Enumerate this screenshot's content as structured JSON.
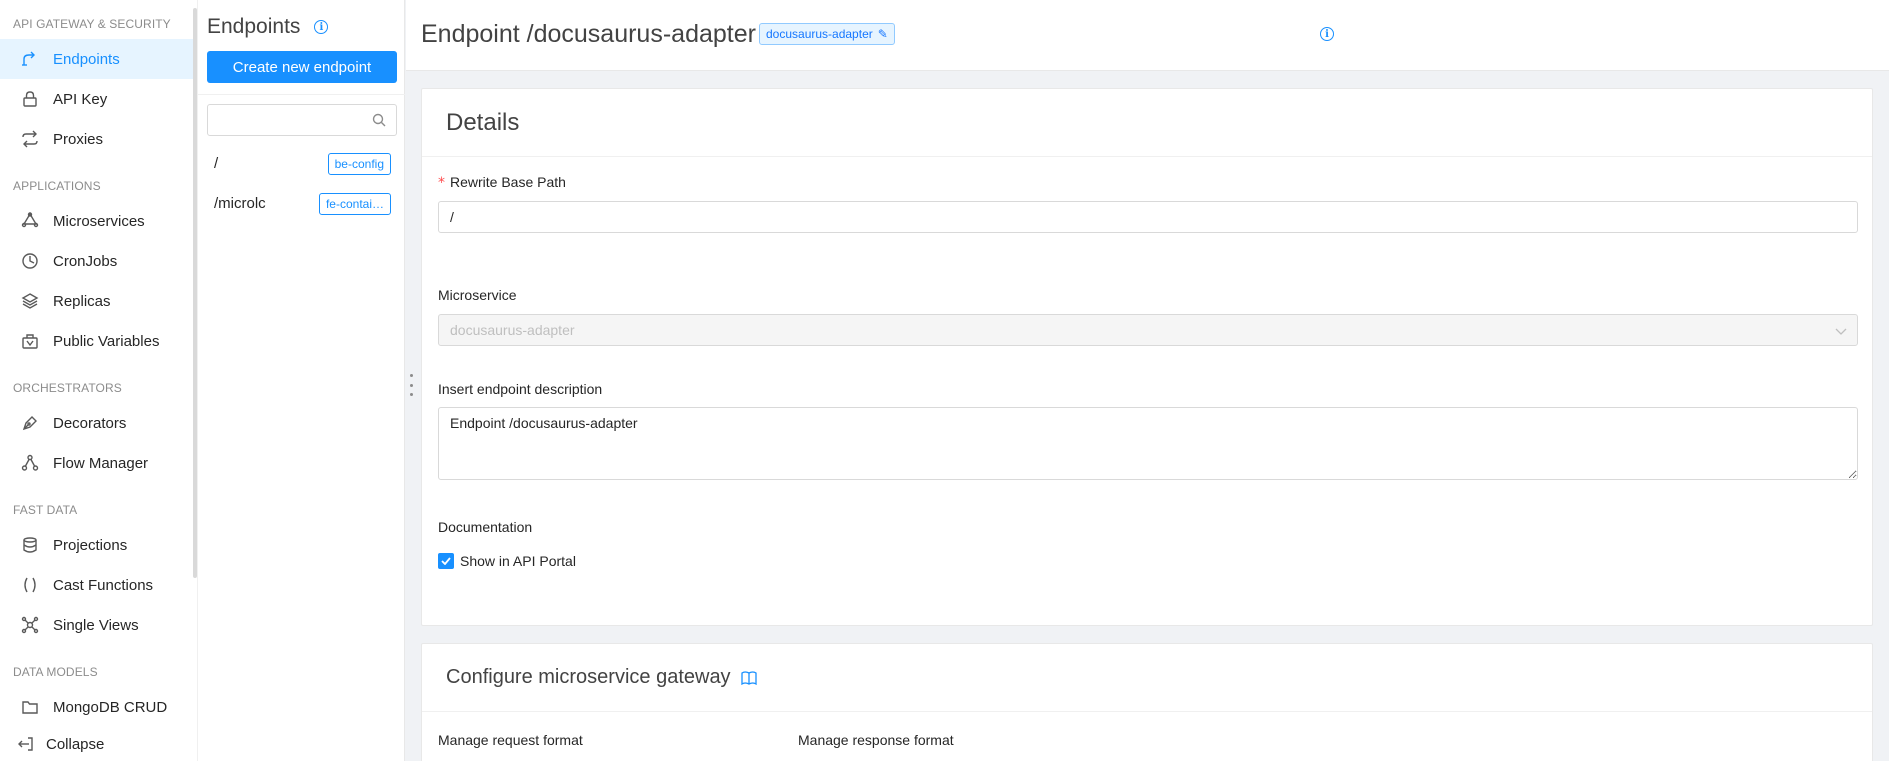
{
  "nav": {
    "sections": {
      "api_gateway": "API GATEWAY & SECURITY",
      "applications": "APPLICATIONS",
      "orchestrators": "ORCHESTRATORS",
      "fast_data": "FAST DATA",
      "data_models": "DATA MODELS"
    },
    "items": {
      "endpoints": "Endpoints",
      "api_key": "API Key",
      "proxies": "Proxies",
      "microservices": "Microservices",
      "cronjobs": "CronJobs",
      "replicas": "Replicas",
      "public_variables": "Public Variables",
      "decorators": "Decorators",
      "flow_manager": "Flow Manager",
      "projections": "Projections",
      "cast_functions": "Cast Functions",
      "single_views": "Single Views",
      "mongodb_crud": "MongoDB CRUD"
    },
    "collapse": "Collapse",
    "active": "endpoints"
  },
  "endpoints_panel": {
    "title": "Endpoints",
    "create_button": "Create new endpoint",
    "search_placeholder": "",
    "list": [
      {
        "path": "/",
        "tag": "be-config"
      },
      {
        "path": "/microlc",
        "tag": "fe-contai…"
      }
    ]
  },
  "header": {
    "title": "Endpoint /docusaurus-adapter",
    "tag": "docusaurus-adapter"
  },
  "details": {
    "title": "Details",
    "rewrite_label": "Rewrite Base Path",
    "rewrite_value": "/",
    "microservice_label": "Microservice",
    "microservice_value": "docusaurus-adapter",
    "description_label": "Insert endpoint description",
    "description_value": "Endpoint /docusaurus-adapter",
    "documentation_label": "Documentation",
    "show_in_portal": "Show in API Portal",
    "show_in_portal_checked": true
  },
  "gateway": {
    "title": "Configure microservice gateway",
    "request_format": "Manage request format",
    "response_format": "Manage response format"
  },
  "colors": {
    "accent": "#1890ff",
    "active_bg": "#e6f4ff",
    "required": "#ff4d4f"
  }
}
